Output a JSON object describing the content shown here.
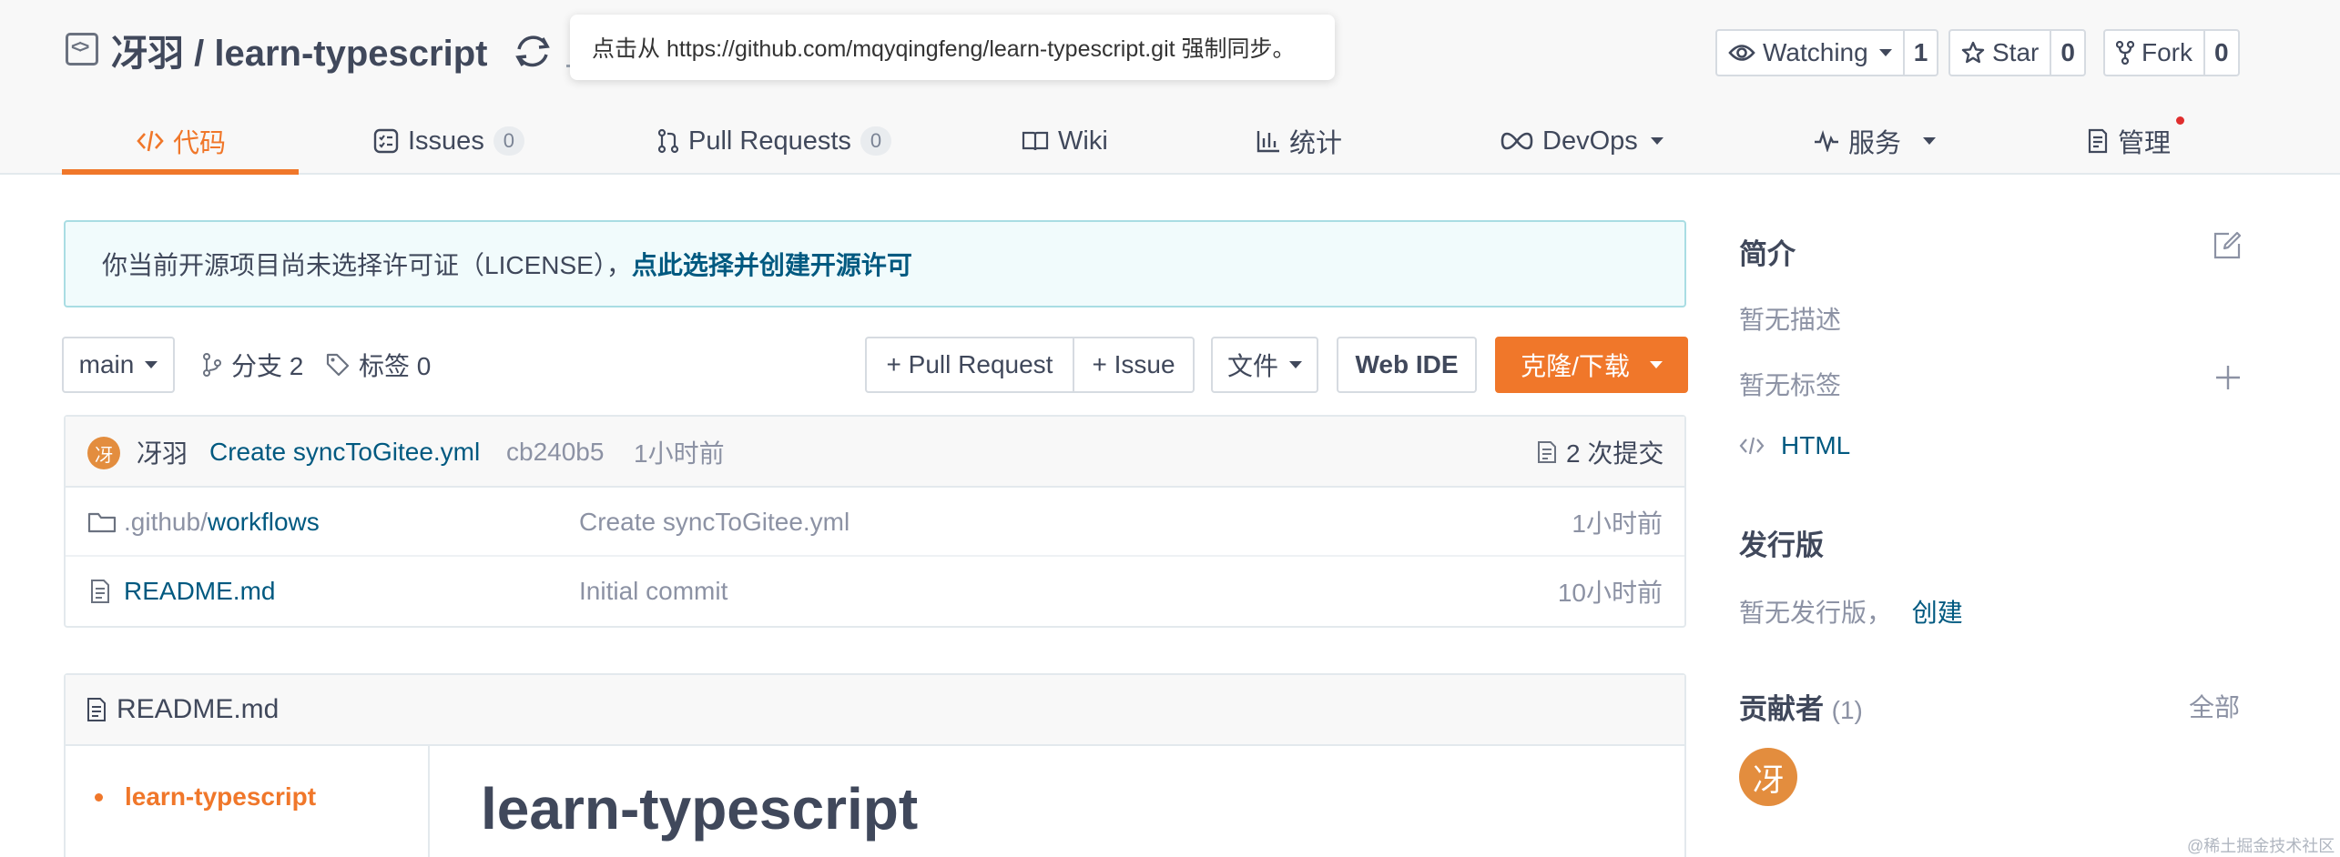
{
  "header": {
    "owner": "冴羽",
    "repo_name": "learn-typescript",
    "tooltip": "点击从 https://github.com/mqyqingfeng/learn-typescript.git 强制同步。",
    "watching_label": "Watching",
    "watching_count": "1",
    "star_label": "Star",
    "star_count": "0",
    "fork_label": "Fork",
    "fork_count": "0"
  },
  "tabs": [
    {
      "label": "代码",
      "active": true
    },
    {
      "label": "Issues",
      "badge": "0"
    },
    {
      "label": "Pull Requests",
      "badge": "0"
    },
    {
      "label": "Wiki"
    },
    {
      "label": "统计"
    },
    {
      "label": "DevOps"
    },
    {
      "label": "服务"
    },
    {
      "label": "管理"
    }
  ],
  "license_banner": {
    "text": "你当前开源项目尚未选择许可证（LICENSE），",
    "link": "点此选择并创建开源许可"
  },
  "toolbar": {
    "branch": "main",
    "branches": "分支 2",
    "tags": "标签 0",
    "pull_request": "+ Pull Request",
    "issue": "+ Issue",
    "files": "文件",
    "web_ide": "Web IDE",
    "clone": "克隆/下载"
  },
  "commit": {
    "avatar": "冴",
    "author": "冴羽",
    "message": "Create syncToGitee.yml",
    "hash": "cb240b5",
    "time": "1小时前",
    "count": "2 次提交"
  },
  "files": [
    {
      "prefix": ".github/",
      "name": "workflows",
      "message": "Create syncToGitee.yml",
      "time": "1小时前",
      "icon": "folder-icon"
    },
    {
      "prefix": "",
      "name": "README.md",
      "message": "Initial commit",
      "time": "10小时前",
      "icon": "file-icon"
    }
  ],
  "readme": {
    "filename": "README.md",
    "toc_item": "learn-typescript",
    "heading": "learn-typescript"
  },
  "sidebar": {
    "intro_title": "简介",
    "no_desc": "暂无描述",
    "no_tags": "暂无标签",
    "language": "HTML",
    "release_title": "发行版",
    "no_release": "暂无发行版，",
    "create": "创建",
    "contributors_title": "贡献者",
    "contributors_count": "(1)",
    "all": "全部",
    "contributor_avatar": "冴"
  },
  "watermark": "@稀土掘金技术社区",
  "colors": {
    "accent": "#f0772a",
    "link": "#005980",
    "text": "#40485b",
    "muted": "#8c92a4"
  }
}
